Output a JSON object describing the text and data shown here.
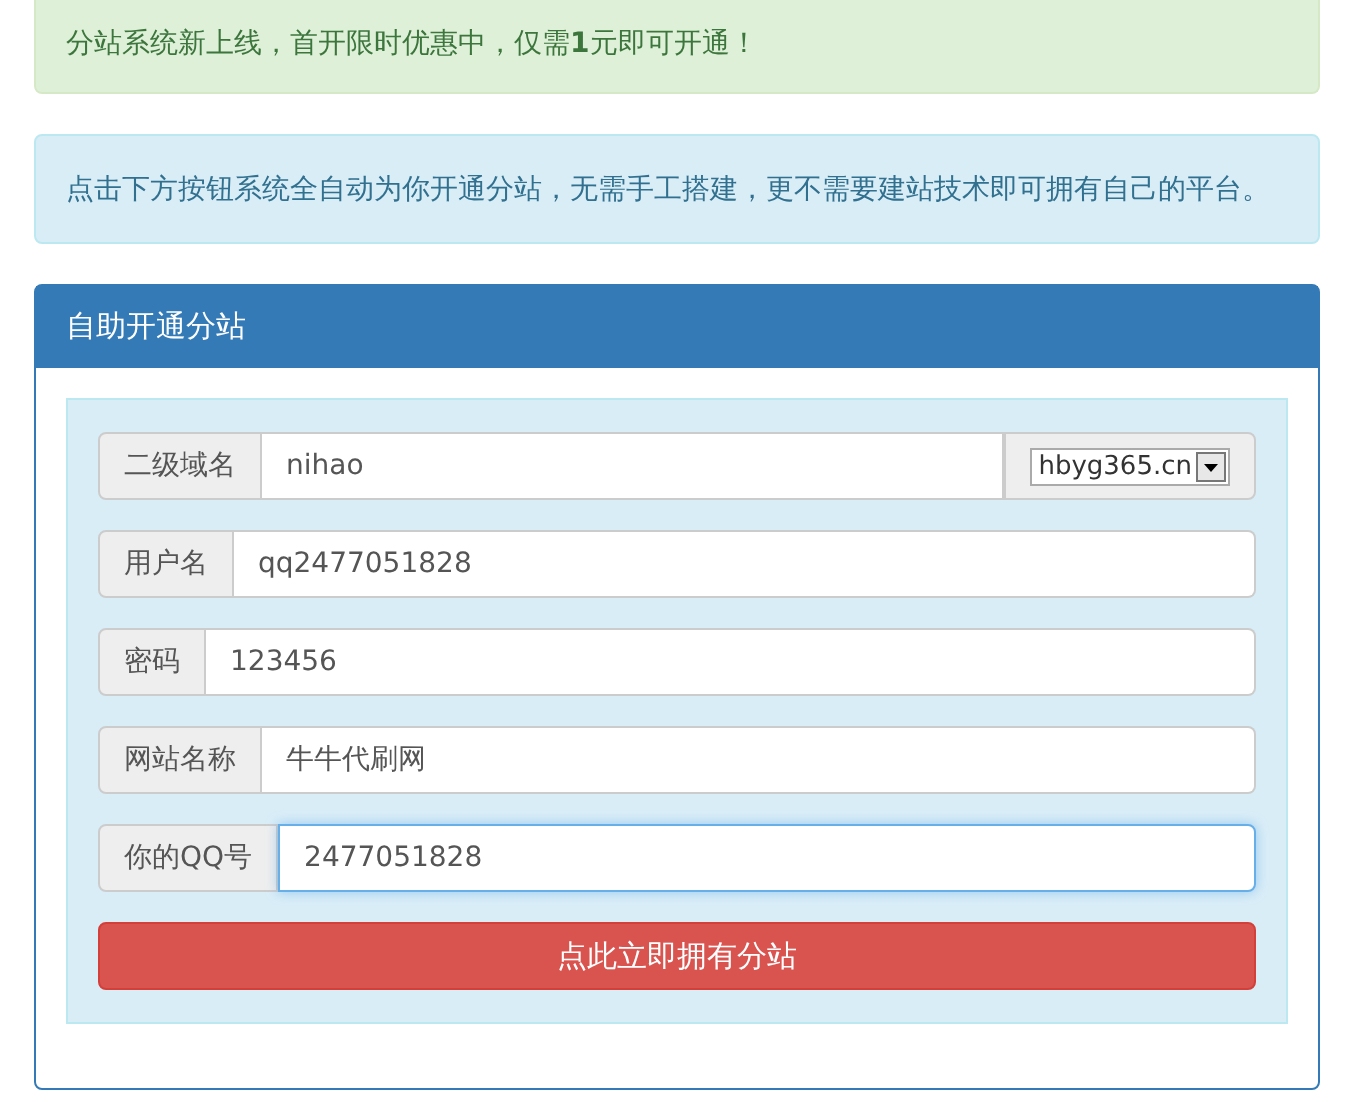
{
  "alerts": [
    {
      "kind": "success",
      "text": "分站系统新上线，首开限时优惠中，仅需**1**元即可开通！"
    },
    {
      "kind": "info",
      "text": "点击下方按钮系统全自动为你开通分站，无需手工搭建，更不需要建站技术即可拥有自己的平台。"
    }
  ],
  "panel": {
    "title": "自助开通分站",
    "fields": [
      {
        "label": "二级域名",
        "value": "nihao",
        "focused": false,
        "suffix_select": "hbyg365.cn"
      },
      {
        "label": "用户名",
        "value": "qq2477051828",
        "focused": false
      },
      {
        "label": "密码",
        "value": "123456",
        "focused": false
      },
      {
        "label": "网站名称",
        "value": "牛牛代刷网",
        "focused": false
      },
      {
        "label": "你的QQ号",
        "value": "2477051828",
        "focused": true
      }
    ],
    "submit_button": "点此立即拥有分站"
  }
}
